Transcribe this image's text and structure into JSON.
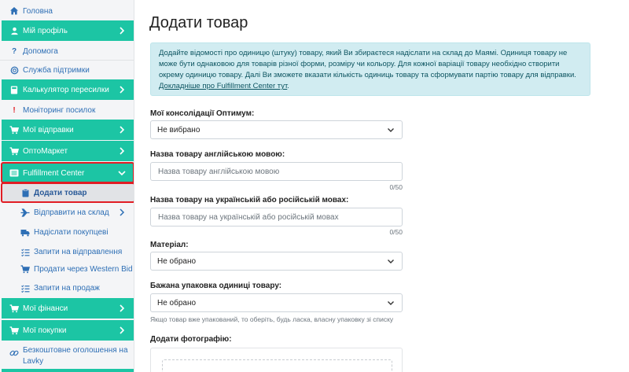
{
  "sidebar": {
    "home": "Головна",
    "profile": "Мій профіль",
    "help": "Допомога",
    "support": "Служба підтримки",
    "calculator": "Калькулятор пересилки",
    "monitoring": "Моніторинг посилок",
    "shipments": "Мої відправки",
    "optomarket": "ОптоМаркет",
    "fulfillment": "Fulfillment Center",
    "sub": {
      "add_product": "Додати товар",
      "send_to_warehouse": "Відправити на склад",
      "send_to_buyer": "Надіслати покупцеві",
      "dispatch_requests": "Запити на відправлення",
      "sell_western_bid": "Продати через Western Bid",
      "sale_requests": "Запити на продаж"
    },
    "finances": "Мої фінанси",
    "purchases": "Мої покупки",
    "lavky": "Безкоштовне оголошення на Lavky"
  },
  "main": {
    "title": "Додати товар",
    "info_text": "Додайте відомості про одиницю (штуку) товару, який Ви збираєтеся надіслати на склад до Маямі. Одиниця товару не може бути однаковою для товарів різної форми, розміру чи кольору. Для кожної варіації товару необхідно створити окрему одиницю товару. Далі Ви зможете вказати кількість одиниць товару та сформувати партію товару для відправки.",
    "info_link": "Докладніше про Fulfillment Center тут",
    "info_link_tail": ".",
    "consolidation_label": "Мої консолідації Оптимум:",
    "consolidation_value": "Не вибрано",
    "name_en_label": "Назва товару англійською мовою:",
    "name_en_placeholder": "Назва товару англійською мовою",
    "name_en_counter": "0/50",
    "name_ua_label": "Назва товару на українській або російській мовах:",
    "name_ua_placeholder": "Назва товару на українській або російській мовах",
    "name_ua_counter": "0/50",
    "material_label": "Матеріал:",
    "material_value": "Не обрано",
    "packaging_label": "Бажана упаковка одиниці товару:",
    "packaging_value": "Не обрано",
    "packaging_hint": "Якщо товар вже упакований, то оберіть, будь ласка, власну упаковку зі списку",
    "photo_label": "Додати фотографію:"
  },
  "colors": {
    "accent": "#1cc5a4",
    "link": "#2e6fb5",
    "highlight": "#e11d24",
    "info_bg": "#d1ecf1"
  }
}
